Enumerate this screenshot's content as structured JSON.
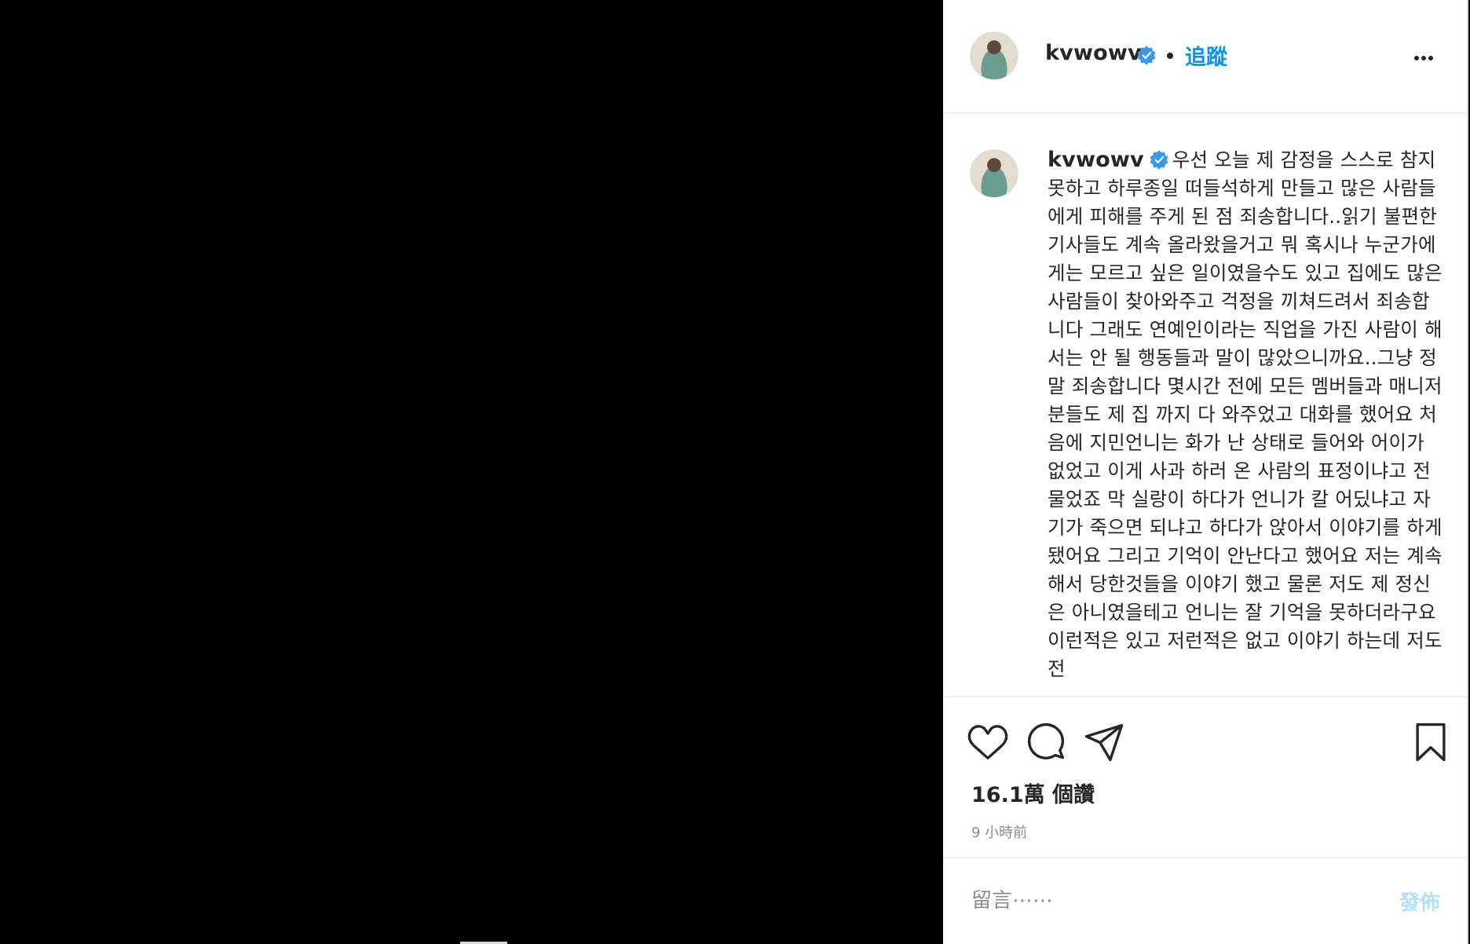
{
  "post": {
    "username": "kvwowv",
    "follow_label": "追蹤",
    "caption": "우선 오늘 제 감정을 스스로 참지 못하고 하루종일 떠들석하게 만들고 많은 사람들에게 피해를 주게 된 점 죄송합니다..읽기 불편한 기사들도 계속 올라왔을거고 뭐 혹시나 누군가에게는 모르고 싶은 일이였을수도 있고 집에도 많은 사람들이 찾아와주고 걱정을 끼쳐드려서 죄송합니다 그래도 연예인이라는 직업을 가진 사람이 해서는 안 될 행동들과 말이 많았으니까요..그냥 정말 죄송합니다 몇시간 전에 모든 멤버들과 매니저분들도 제 집 까지 다 와주었고 대화를 했어요 처음에 지민언니는 화가 난 상태로 들어와 어이가 없었고 이게 사과 하러 온 사람의 표정이냐고 전 물었죠 막 실랑이 하다가 언니가 칼 어딨냐고 자기가 죽으면 되냐고 하다가 앉아서 이야기를 하게 됐어요 그리고 기억이 안난다고 했어요 저는 계속해서 당한것들을 이야기 했고 물론 저도 제 정신은 아니였을테고 언니는 잘 기억을 못하더라구요 이런적은 있고 저런적은 없고 이야기 하는데 저도 전",
    "likes": "16.1萬 個讚",
    "timestamp": "9 小時前",
    "comment_placeholder": "留言⋯⋯",
    "post_label": "發佈"
  },
  "icons": {
    "avatar": "profile-avatar",
    "verified": "verified-badge-icon",
    "more": "more-options-icon",
    "like": "heart-icon",
    "comment": "comment-bubble-icon",
    "share": "paper-plane-icon",
    "save": "bookmark-icon"
  },
  "colors": {
    "accent": "#0095f6",
    "post_disabled": "#b2dffc",
    "text": "#262626",
    "muted": "#8e8e8e",
    "media_bg": "#000000"
  }
}
